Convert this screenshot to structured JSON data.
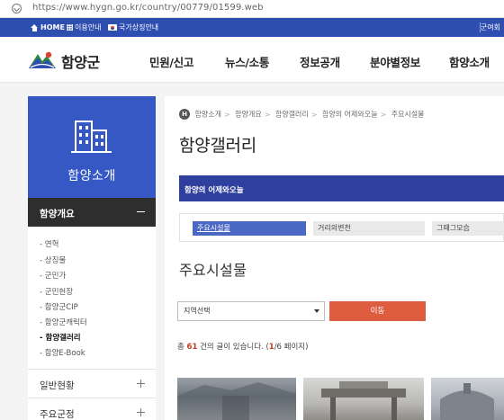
{
  "browser": {
    "url": "https://www.hygn.go.kr/country/00779/01599.web"
  },
  "utility": {
    "home": "HOME",
    "guide": "이용안내",
    "symbol": "국가상징안내",
    "right": "군여회"
  },
  "header": {
    "logo_text": "함양군",
    "nav": [
      "민원/신고",
      "뉴스/소통",
      "정보공개",
      "분야별정보",
      "함양소개"
    ]
  },
  "sidebar": {
    "title": "함양소개",
    "active_section": "함양개요",
    "sub_items": [
      "연혁",
      "상징물",
      "군민가",
      "군민헌장",
      "함양군CIP",
      "함양군캐릭터",
      "함양갤러리",
      "함양E-Book"
    ],
    "active_sub": "함양갤러리",
    "sections": [
      "일반현황",
      "주요군정"
    ]
  },
  "breadcrumb": {
    "home": "H",
    "items": [
      "함양소개",
      "함양개요",
      "함양갤러리",
      "함양의 어제와오늘",
      "주요시설물"
    ]
  },
  "main": {
    "page_title": "함양갤러리",
    "category": "함양의 어제와오늘",
    "tabs": [
      "주요시설물",
      "거리의변천",
      "그때그모습"
    ],
    "section_title": "주요시설물",
    "select_value": "지역선택",
    "go_button": "이동",
    "count": {
      "prefix": "총",
      "total": "61",
      "middle": "건의 글이 있습니다. (",
      "page": "1",
      "pages": "/6 페이지)"
    }
  },
  "colors": {
    "primary": "#2f4fb0",
    "sidebar": "#3558c4",
    "category": "#2f3f9e",
    "button": "#de5d3f"
  }
}
